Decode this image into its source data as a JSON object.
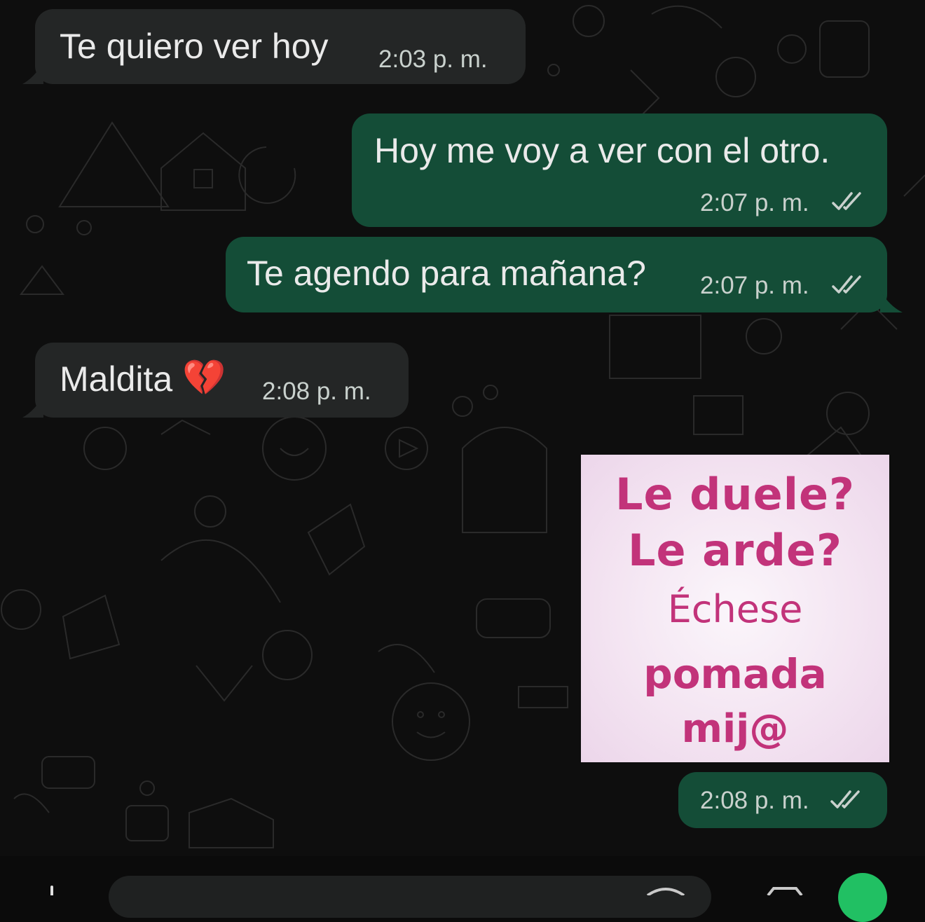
{
  "theme": {
    "incoming_bubble": "#242626",
    "outgoing_bubble": "#144d37",
    "wallpaper": "#0e0e0e",
    "accent": "#21c063",
    "image_text": "#c2337a"
  },
  "messages": [
    {
      "direction": "incoming",
      "text": "Te quiero ver hoy",
      "time": "2:03 p. m."
    },
    {
      "direction": "outgoing",
      "text": "Hoy me voy a ver con el otro.",
      "time": "2:07 p. m.",
      "status": "double-check-icon"
    },
    {
      "direction": "outgoing",
      "text": "Te agendo para mañana?",
      "time": "2:07 p. m.",
      "status": "double-check-icon"
    },
    {
      "direction": "incoming",
      "text": "Maldita",
      "emoji": "💔",
      "time": "2:08 p. m."
    },
    {
      "direction": "outgoing",
      "type": "image",
      "image_lines": [
        "Le duele?",
        "Le arde?",
        "Échese",
        "pomada",
        "mij@"
      ],
      "time": "2:08 p. m.",
      "status": "double-check-icon"
    }
  ],
  "composer": {
    "left_icon": "plus-icon",
    "right_icons": [
      "sticker-icon",
      "camera-icon"
    ],
    "send_icon": "mic-icon"
  }
}
